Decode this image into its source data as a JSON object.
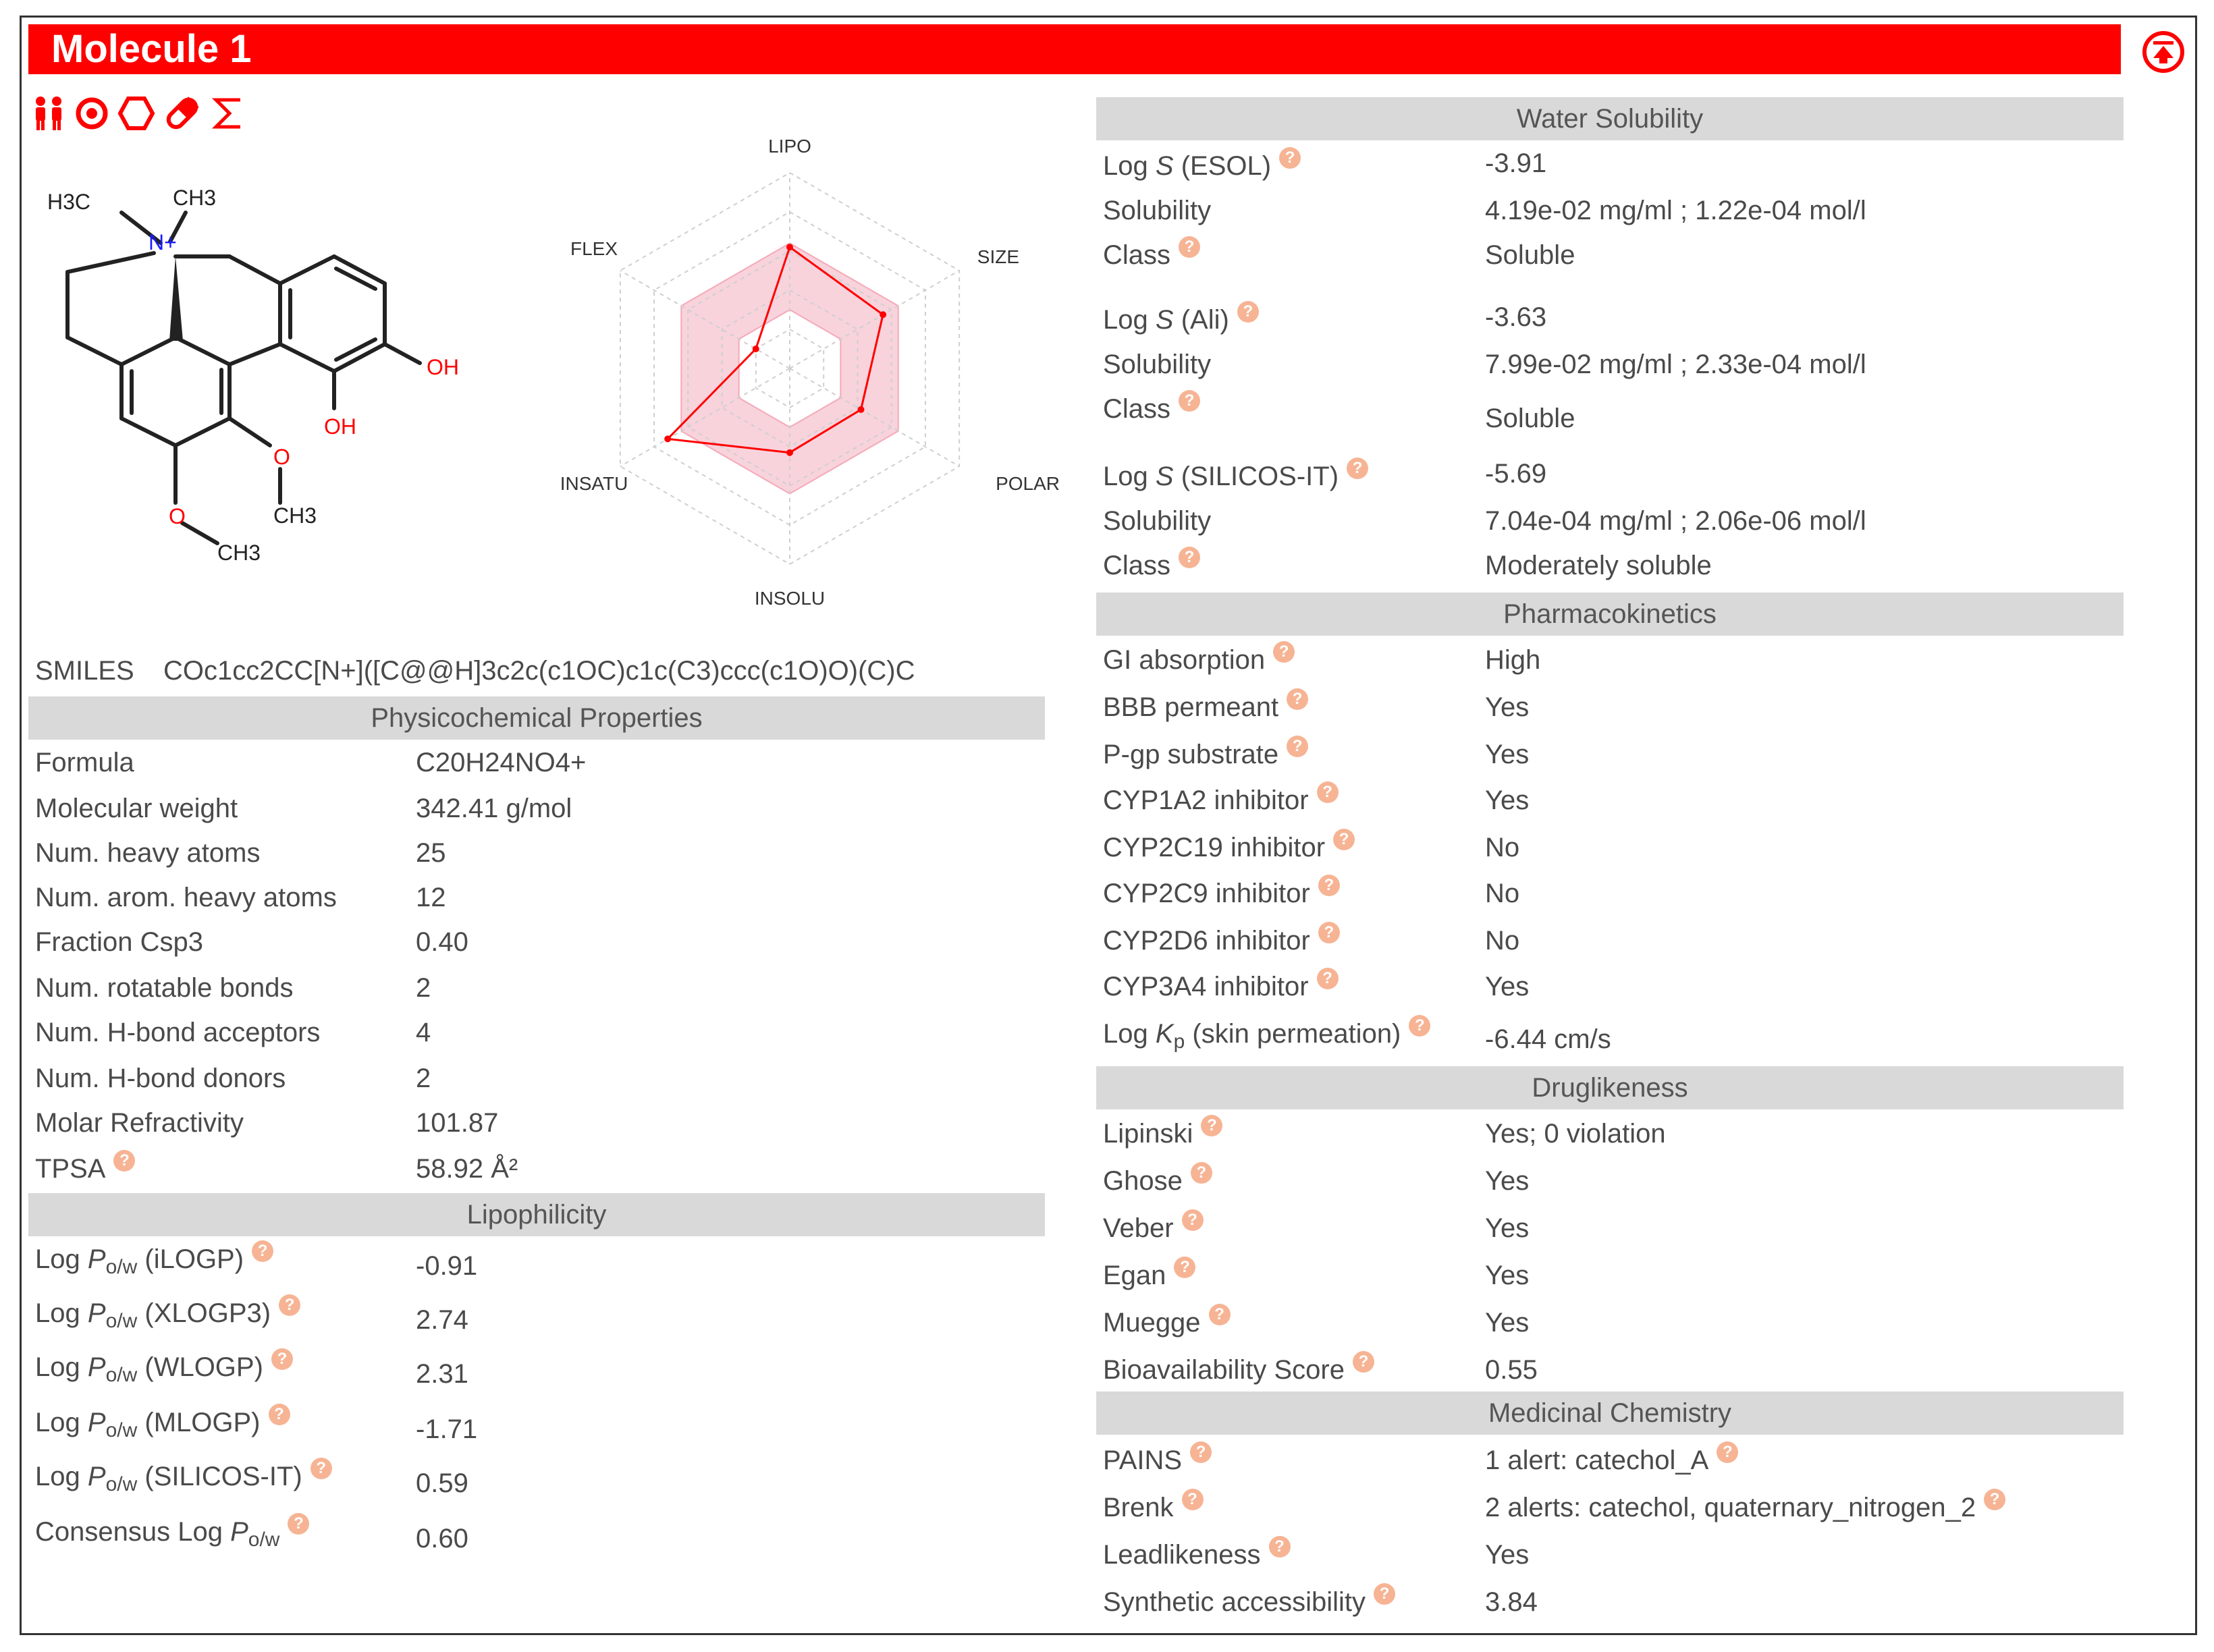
{
  "title": "Molecule 1",
  "toolbar_icons": [
    "lipinski-people-icon",
    "target-icon",
    "hexagon-icon",
    "capsule-icon",
    "sigma-icon"
  ],
  "accent_color": "#ff0000",
  "help_glyph": "?",
  "molecule": {
    "labels": {
      "h3c": "H3C",
      "ch3_top": "CH3",
      "n_plus": "N+",
      "oh1": "OH",
      "oh2": "OH",
      "o1": "O",
      "ch3_a": "CH3",
      "o2": "O",
      "ch3_b": "CH3"
    }
  },
  "radar": {
    "axes": [
      "LIPO",
      "SIZE",
      "POLAR",
      "INSOLU",
      "INSATU",
      "FLEX"
    ],
    "values": [
      0.62,
      0.55,
      0.42,
      0.43,
      0.72,
      0.2
    ]
  },
  "smiles": {
    "label": "SMILES",
    "value": "COc1cc2CC[N+]([C@@H]3c2c(c1OC)c1c(C3)ccc(c1O)O)(C)C"
  },
  "physchem": {
    "header": "Physicochemical Properties",
    "rows": [
      {
        "label": "Formula",
        "value": "C20H24NO4+"
      },
      {
        "label": "Molecular weight",
        "value": "342.41 g/mol"
      },
      {
        "label": "Num. heavy atoms",
        "value": "25"
      },
      {
        "label": "Num. arom. heavy atoms",
        "value": "12"
      },
      {
        "label": "Fraction Csp3",
        "value": "0.40"
      },
      {
        "label": "Num. rotatable bonds",
        "value": "2"
      },
      {
        "label": "Num. H-bond acceptors",
        "value": "4"
      },
      {
        "label": "Num. H-bond donors",
        "value": "2"
      },
      {
        "label": "Molar Refractivity",
        "value": "101.87"
      },
      {
        "label": "TPSA",
        "value": "58.92 Å²"
      }
    ]
  },
  "lipophilicity": {
    "header": "Lipophilicity",
    "log_prefix": "Log",
    "consensus_prefix": "Consensus Log",
    "p": "P",
    "ow": "o/w",
    "rows": [
      {
        "method": "(iLOGP)",
        "value": "-0.91"
      },
      {
        "method": "(XLOGP3)",
        "value": "2.74"
      },
      {
        "method": "(WLOGP)",
        "value": "2.31"
      },
      {
        "method": "(MLOGP)",
        "value": "-1.71"
      },
      {
        "method": "(SILICOS-IT)",
        "value": "0.59"
      },
      {
        "value": "0.60"
      }
    ]
  },
  "water_solubility": {
    "header": "Water Solubility",
    "log": "Log",
    "s": "S",
    "solubility_label": "Solubility",
    "class_label": "Class",
    "groups": [
      {
        "method": "(ESOL)",
        "log_s": "-3.91",
        "solubility": "4.19e-02 mg/ml ; 1.22e-04 mol/l",
        "class": "Soluble"
      },
      {
        "method": "(Ali)",
        "log_s": "-3.63",
        "solubility": "7.99e-02 mg/ml ; 2.33e-04 mol/l",
        "class": "Soluble"
      },
      {
        "method": "(SILICOS-IT)",
        "log_s": "-5.69",
        "solubility": "7.04e-04 mg/ml ; 2.06e-06 mol/l",
        "class": "Moderately soluble"
      }
    ]
  },
  "pharmacokinetics": {
    "header": "Pharmacokinetics",
    "rows": [
      {
        "label": "GI absorption",
        "value": "High"
      },
      {
        "label": "BBB permeant",
        "value": "Yes"
      },
      {
        "label": "P-gp substrate",
        "value": "Yes"
      },
      {
        "label": "CYP1A2 inhibitor",
        "value": "Yes"
      },
      {
        "label": "CYP2C19 inhibitor",
        "value": "No"
      },
      {
        "label": "CYP2C9 inhibitor",
        "value": "No"
      },
      {
        "label": "CYP2D6 inhibitor",
        "value": "No"
      },
      {
        "label": "CYP3A4 inhibitor",
        "value": "Yes"
      }
    ],
    "kp": {
      "prefix": "Log",
      "k": "K",
      "p": "p",
      "suffix": "(skin permeation)",
      "value": "-6.44 cm/s"
    }
  },
  "druglikeness": {
    "header": "Druglikeness",
    "rows": [
      {
        "label": "Lipinski",
        "value": "Yes; 0 violation"
      },
      {
        "label": "Ghose",
        "value": "Yes"
      },
      {
        "label": "Veber",
        "value": "Yes"
      },
      {
        "label": "Egan",
        "value": "Yes"
      },
      {
        "label": "Muegge",
        "value": "Yes"
      },
      {
        "label": "Bioavailability Score",
        "value": "0.55"
      }
    ]
  },
  "medchem": {
    "header": "Medicinal Chemistry",
    "rows": [
      {
        "label": "PAINS",
        "value": "1 alert: catechol_A"
      },
      {
        "label": "Brenk",
        "value": "2 alerts: catechol, quaternary_nitrogen_2"
      },
      {
        "label": "Leadlikeness",
        "value": "Yes"
      },
      {
        "label": "Synthetic accessibility",
        "value": "3.84"
      }
    ]
  }
}
